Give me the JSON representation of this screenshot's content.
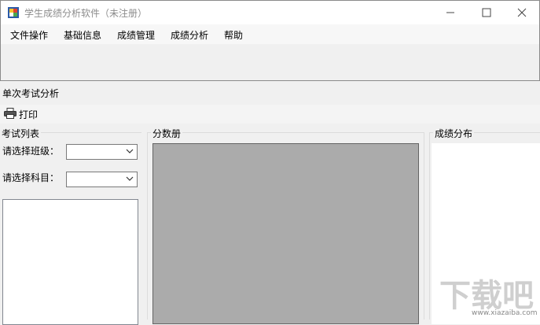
{
  "window": {
    "title": "学生成绩分析软件（未注册）",
    "controls": {
      "minimize": "—",
      "maximize": "☐",
      "close": "✕"
    }
  },
  "menu": {
    "items": [
      "文件操作",
      "基础信息",
      "成绩管理",
      "成绩分析",
      "帮助"
    ]
  },
  "section": {
    "title": "单次考试分析"
  },
  "toolbar": {
    "print_label": "打印",
    "print_icon": "printer-icon"
  },
  "exam_list": {
    "group_title": "考试列表",
    "class_label": "请选择班级：",
    "class_value": "",
    "subject_label": "请选择科目：",
    "subject_value": ""
  },
  "score_book": {
    "group_title": "分数册"
  },
  "distribution": {
    "group_title": "成绩分布"
  },
  "watermark": {
    "text": "下载吧",
    "url": "www.xiazaiba.com"
  }
}
